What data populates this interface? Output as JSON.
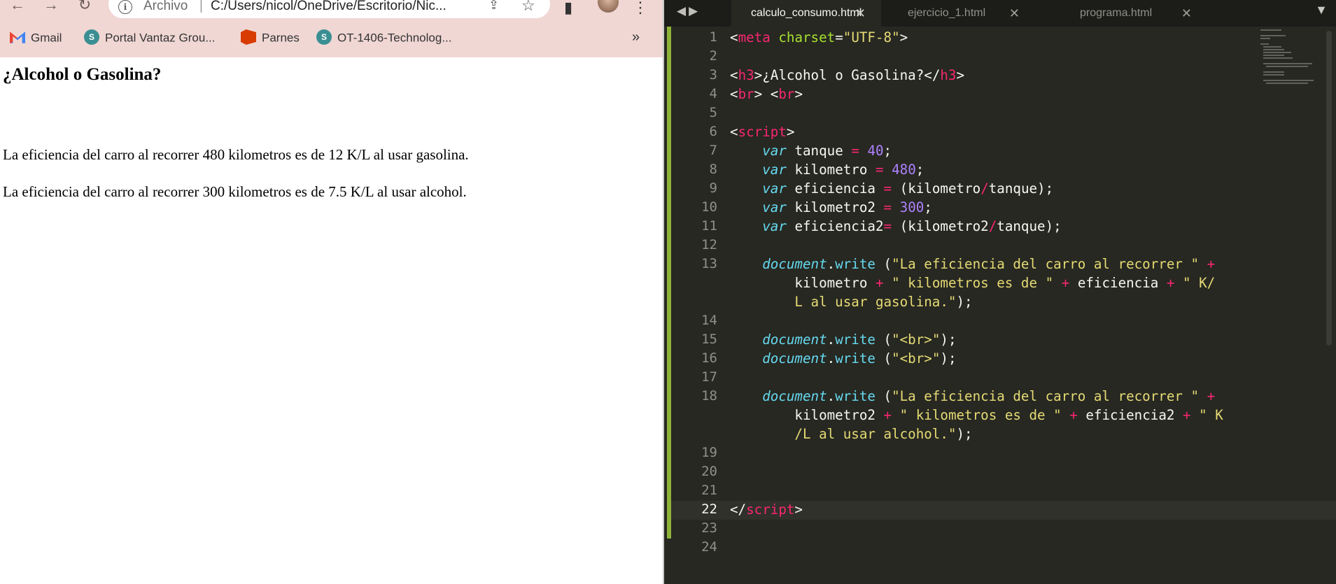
{
  "browser": {
    "nav": {
      "back_icon": "arrow-left-icon",
      "forward_icon": "arrow-right-icon",
      "reload_icon": "reload-icon"
    },
    "address": {
      "scheme_label": "Archivo",
      "separator": "|",
      "url": "C:/Users/nicol/OneDrive/Escritorio/Nic..."
    },
    "bookmarks": [
      {
        "label": "Gmail",
        "icon": "gmail-icon"
      },
      {
        "label": "Portal Vantaz Grou...",
        "icon": "sharepoint-icon"
      },
      {
        "label": "Parnes",
        "icon": "office-icon"
      },
      {
        "label": "OT-1406-Technolog...",
        "icon": "sharepoint-icon"
      }
    ],
    "bookmarks_more": "»",
    "page": {
      "heading": "¿Alcohol o Gasolina?",
      "line1": "La eficiencia del carro al recorrer 480 kilometros es de 12 K/L al usar gasolina.",
      "line2": "La eficiencia del carro al recorrer 300 kilometros es de 7.5 K/L al usar alcohol."
    }
  },
  "editor": {
    "tabs": [
      {
        "label": "calculo_consumo.html",
        "active": true
      },
      {
        "label": "ejercicio_1.html",
        "active": false
      },
      {
        "label": "programa.html",
        "active": false
      }
    ],
    "tab_close_glyph": "✕",
    "current_line": 22,
    "line_numbers": [
      "1",
      "2",
      "3",
      "4",
      "5",
      "6",
      "7",
      "8",
      "9",
      "10",
      "11",
      "12",
      "13",
      "14",
      "15",
      "16",
      "17",
      "18",
      "19",
      "20",
      "21",
      "22",
      "23",
      "24"
    ],
    "code": {
      "l1": {
        "open": "<",
        "tag": "meta",
        "attr": "charset",
        "eq": "=",
        "val": "\"UTF-8\"",
        "close": ">"
      },
      "l3": {
        "a": "<",
        "tag": "h3",
        "b": ">¿Alcohol o Gasolina?</",
        "tag2": "h3",
        "c": ">"
      },
      "l4": {
        "a": "<",
        "tag": "br",
        "b": "> <",
        "tag2": "br",
        "c": ">"
      },
      "l6": {
        "a": "<",
        "tag": "script",
        "b": ">"
      },
      "l7": {
        "kw": "var",
        "name": "tanque",
        "op": "=",
        "num": "40",
        "end": ";"
      },
      "l8": {
        "kw": "var",
        "name": "kilometro",
        "op": "=",
        "num": "480",
        "end": ";"
      },
      "l9": {
        "kw": "var",
        "name": "eficiencia",
        "op": "=",
        "a": "(kilometro",
        "div": "/",
        "b": "tanque);"
      },
      "l10": {
        "kw": "var",
        "name": "kilometro2",
        "op": "=",
        "num": "300",
        "end": ";"
      },
      "l11": {
        "kw": "var",
        "name": "eficiencia2",
        "op": "=",
        "a": "(kilometro2",
        "div": "/",
        "b": "tanque);"
      },
      "l13": {
        "obj": "document",
        "dot": ".",
        "fn": "write",
        "paren": " (",
        "s1": "\"La eficiencia del carro al recorrer \"",
        "plus": "+",
        "w1": "kilometro",
        "s2": "\" kilometros es de \"",
        "w2": "eficiencia",
        "s3a": "\" K/",
        "s3b": "L al usar gasolina.\"",
        "end": ");"
      },
      "l15": {
        "obj": "document",
        "dot": ".",
        "fn": "write",
        "paren": " (",
        "s": "\"<br>\"",
        "end": ");"
      },
      "l16": {
        "obj": "document",
        "dot": ".",
        "fn": "write",
        "paren": " (",
        "s": "\"<br>\"",
        "end": ");"
      },
      "l18": {
        "obj": "document",
        "dot": ".",
        "fn": "write",
        "paren": " (",
        "s1": "\"La eficiencia del carro al recorrer \"",
        "plus": "+",
        "w1": "kilometro2",
        "s2": "\" kilometros es de \"",
        "w2": "eficiencia2",
        "s3a": "\" K",
        "s3b": "/L al usar alcohol.\"",
        "end": ");"
      },
      "l22": {
        "a": "</",
        "tag": "script",
        "b": ">"
      }
    }
  }
}
